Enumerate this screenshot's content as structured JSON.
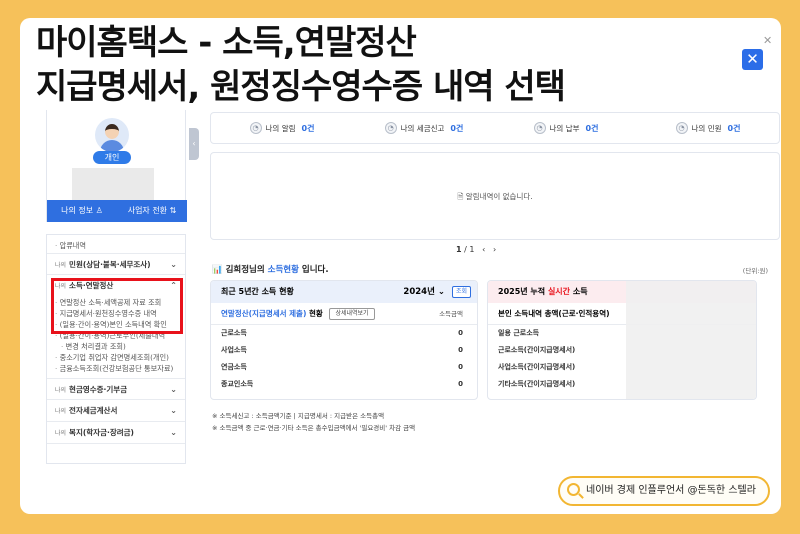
{
  "overlay_title": {
    "line1": "마이홈택스 - 소득,연말정산",
    "line2": "지급명세서, 원정징수영수증 내역 선택"
  },
  "close_icon": "close-icon",
  "profile": {
    "badge": "개인",
    "my_info": "나의 정보",
    "business_switch": "사업자 전환"
  },
  "menu": {
    "top_sub": "압류내역",
    "sections": [
      {
        "pre": "나의",
        "label": "민원(상담·불복·세무조사)"
      },
      {
        "pre": "나의",
        "label": "소득·연말정산"
      },
      {
        "pre": "나의",
        "label": "현금영수증·기부금"
      },
      {
        "pre": "나의",
        "label": "전자세금계산서"
      },
      {
        "pre": "나의",
        "label": "복지(학자금·장려금)"
      }
    ],
    "income_subs": [
      "연말정산 소득·세액공제 자료 조회",
      "지급명세서·원천징수영수증 내역",
      "(일용·간이·용역)본인 소득내역 확인",
      "(일용·간이·용역)근로부인(제출내역",
      "변경 처리결과 조회)",
      "중소기업 취업자 감면명세조회(개인)",
      "금융소득조회(건강보험공단 통보자료)"
    ]
  },
  "stats": [
    {
      "label": "나의 알림",
      "value": "0건"
    },
    {
      "label": "나의 세금신고",
      "value": "0건"
    },
    {
      "label": "나의 납부",
      "value": "0건"
    },
    {
      "label": "나의 민원",
      "value": "0건"
    }
  ],
  "notice": {
    "empty_text": "알림내역이 없습니다."
  },
  "pager": {
    "current": "1",
    "total": "1",
    "prev": "‹",
    "next": "›"
  },
  "income_status": {
    "name_prefix": "김희정님의",
    "highlight": "소득현황",
    "suffix": "입니다.",
    "unit": "(단위:원)"
  },
  "left_panel": {
    "title": "최근 5년간 소득 현황",
    "year": "2024년",
    "query_button": "조회",
    "sub_title_blue": "연말정산(지급명세서 제출)",
    "sub_title_rest": "현황",
    "detail_button": "상세내역보기",
    "col_header": "소득금액",
    "rows": [
      {
        "label": "근로소득",
        "value": "0"
      },
      {
        "label": "사업소득",
        "value": "0"
      },
      {
        "label": "연금소득",
        "value": "0"
      },
      {
        "label": "종교인소득",
        "value": "0"
      }
    ]
  },
  "right_panel": {
    "title_prefix": "2025년 누적",
    "title_red": "실시간",
    "title_suffix": "소득",
    "sub_title": "본인 소득내역 총액(근로·인적용역)",
    "rows": [
      {
        "label": "일용 근로소득"
      },
      {
        "label": "근로소득(간이지급명세서)"
      },
      {
        "label": "사업소득(간이지급명세서)"
      },
      {
        "label": "기타소득(간이지급명세서)"
      }
    ]
  },
  "notes": [
    "※ 소득세신고 : 소득금액기준   |   지급명세서 : 지급받은 소득총액",
    "※ 소득금액 중 근로·연금·기타 소득은 총수입금액에서 '필요경비' 차감 금액"
  ],
  "footer_tag": "네이버 경제 인플루언서 @돈독한 스텔라",
  "colors": {
    "background": "#f6c15a",
    "accent_blue": "#2f6fe0",
    "highlight_red": "#e8121b"
  }
}
